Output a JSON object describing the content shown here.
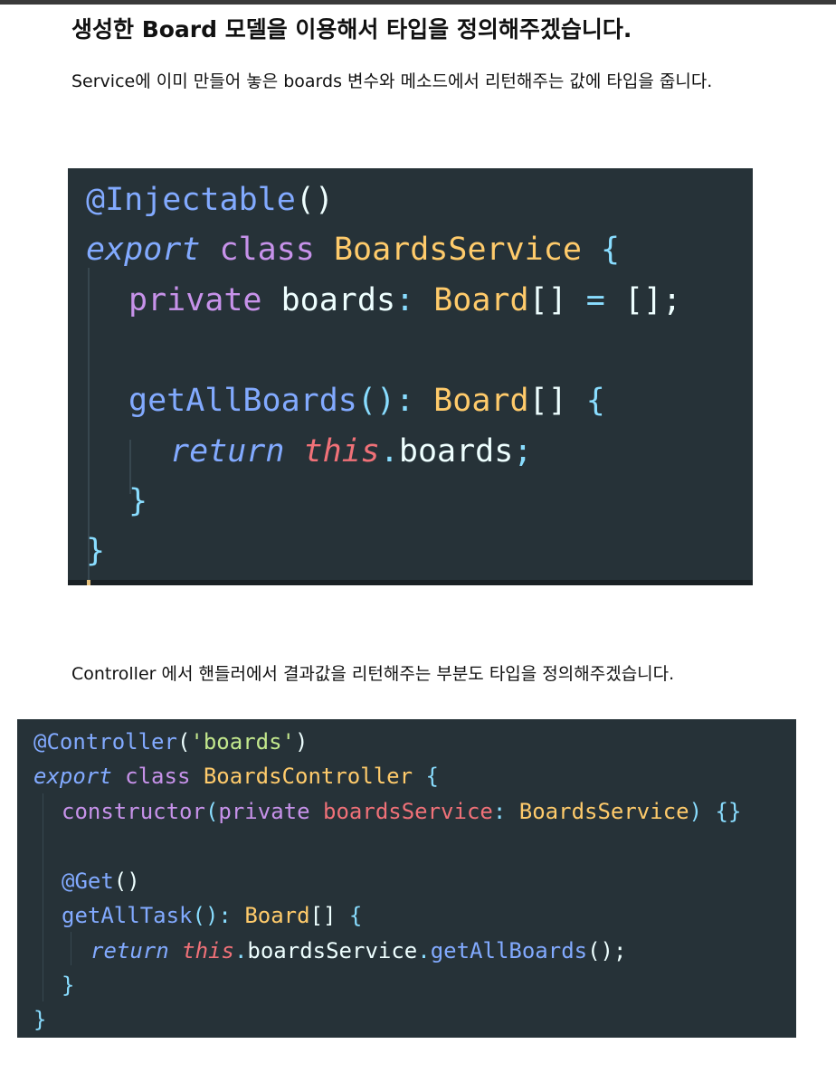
{
  "heading": "생성한 Board 모델을 이용해서 타입을 정의해주겠습니다.",
  "paragraph1": "Service에 이미 만들어 놓은 boards 변수와   메소드에서 리턴해주는 값에 타입을 줍니다.",
  "paragraph2": "Controller 에서 핸들러에서 결과값을 리턴해주는 부분도 타입을 정의해주겠습니다.",
  "code1": {
    "l1": {
      "deco": "@Injectable",
      "punc": "()"
    },
    "l2": {
      "export": "export",
      "class": "class",
      "name": "BoardsService",
      "brace": "{"
    },
    "l3": {
      "private": "private",
      "field": "boards",
      "colon": ":",
      "type": "Board",
      "arr": "[]",
      "eq": "=",
      "init": "[];"
    },
    "l5": {
      "method": "getAllBoards",
      "paren": "():",
      "type": "Board",
      "arr": "[]",
      "brace": "{"
    },
    "l6": {
      "return": "return",
      "this": "this",
      "dot": ".",
      "field": "boards",
      "semi": ";"
    },
    "l7": {
      "close": "}"
    },
    "l8": {
      "close": "}"
    }
  },
  "code2": {
    "l1": {
      "deco": "@Controller",
      "open": "(",
      "str": "'boards'",
      "close": ")"
    },
    "l2": {
      "export": "export",
      "class": "class",
      "name": "BoardsController",
      "brace": "{"
    },
    "l3": {
      "ctor": "constructor",
      "open": "(",
      "private": "private",
      "param": "boardsService",
      "colon": ":",
      "type": "BoardsService",
      "close": ")",
      "body": "{}"
    },
    "l5": {
      "deco": "@Get",
      "punc": "()"
    },
    "l6": {
      "method": "getAllTask",
      "paren": "():",
      "type": "Board",
      "arr": "[]",
      "brace": "{"
    },
    "l7": {
      "return": "return",
      "this": "this",
      "dot1": ".",
      "field": "boardsService",
      "dot2": ".",
      "call": "getAllBoards",
      "end": "();"
    },
    "l8": {
      "close": "}"
    },
    "l9": {
      "close": "}"
    }
  }
}
